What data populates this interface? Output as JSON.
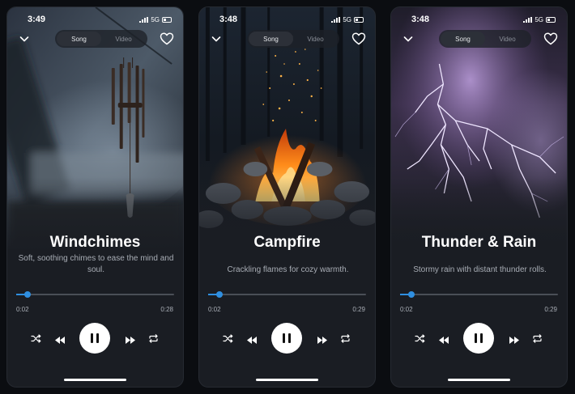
{
  "screens": [
    {
      "status": {
        "time": "3:49",
        "network": "5G"
      },
      "tabs": {
        "song": "Song",
        "video": "Video",
        "selected": "song"
      },
      "title": "Windchimes",
      "subtitle": "Soft, soothing chimes to ease the mind and soul.",
      "elapsed": "0:02",
      "duration": "0:28",
      "progress": 0.07,
      "artwork": "windchimes-photo"
    },
    {
      "status": {
        "time": "3:48",
        "network": "5G"
      },
      "tabs": {
        "song": "Song",
        "video": "Video",
        "selected": "song"
      },
      "title": "Campfire",
      "subtitle": "Crackling flames for cozy warmth.",
      "elapsed": "0:02",
      "duration": "0:29",
      "progress": 0.07,
      "artwork": "campfire-photo"
    },
    {
      "status": {
        "time": "3:48",
        "network": "5G"
      },
      "tabs": {
        "song": "Song",
        "video": "Video",
        "selected": "song"
      },
      "title": "Thunder & Rain",
      "subtitle": "Stormy rain with distant thunder rolls.",
      "elapsed": "0:02",
      "duration": "0:29",
      "progress": 0.07,
      "artwork": "lightning-storm-photo"
    }
  ],
  "icons": [
    "chevron-down-icon",
    "heart-icon",
    "shuffle-icon",
    "rewind-icon",
    "pause-icon",
    "fast-forward-icon",
    "repeat-icon"
  ],
  "colors": {
    "background": "#0b0d11",
    "card": "#1a1d23",
    "accent": "#2f8fe0",
    "play_button": "#ffffff"
  }
}
